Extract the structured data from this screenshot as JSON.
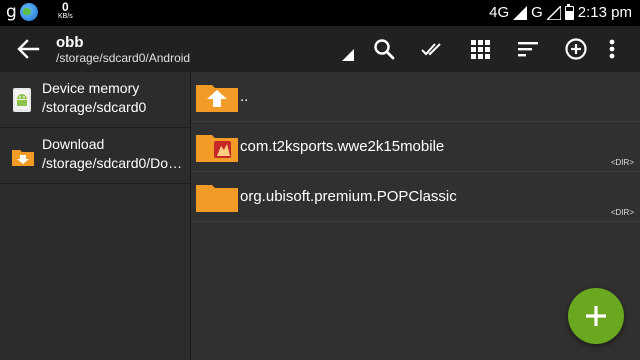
{
  "status_bar": {
    "left_letter": "g",
    "speed_value": "0",
    "speed_unit": "KB/s",
    "network_1": "4G",
    "network_2": "G",
    "time": "2:13 pm"
  },
  "toolbar": {
    "title": "obb",
    "path": "/storage/sdcard0/Android",
    "icons": [
      "back-arrow-icon",
      "search-icon",
      "select-all-icon",
      "grid-view-icon",
      "sort-icon",
      "add-circle-icon",
      "more-vert-icon"
    ]
  },
  "sidebar": {
    "items": [
      {
        "name": "Device memory",
        "path": "/storage/sdcard0",
        "icon": "android-device-icon"
      },
      {
        "name": "Download",
        "path": "/storage/sdcard0/Do…",
        "icon": "download-folder-icon"
      }
    ]
  },
  "files": [
    {
      "name": "..",
      "tag": "",
      "icon": "parent-folder-icon"
    },
    {
      "name": "com.t2ksports.wwe2k15mobile",
      "tag": "<DIR>",
      "icon": "app-folder-icon"
    },
    {
      "name": "org.ubisoft.premium.POPClassic",
      "tag": "<DIR>",
      "icon": "folder-icon"
    }
  ],
  "colors": {
    "background": "#303030",
    "toolbar": "#212121",
    "folder": "#f39b27",
    "fab": "#6aa81f"
  },
  "fab": {
    "icon": "plus-icon"
  }
}
